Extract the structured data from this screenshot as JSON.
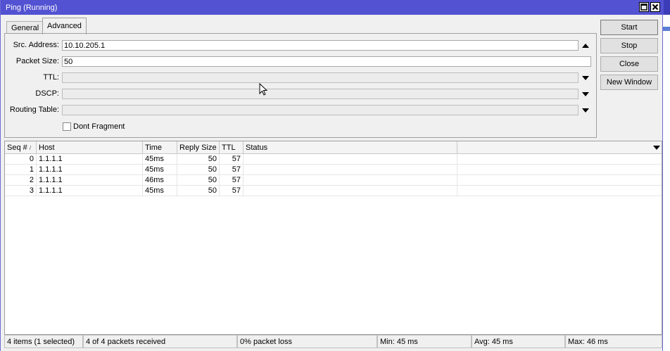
{
  "window": {
    "title": "Ping (Running)"
  },
  "tabs": [
    {
      "label": "General"
    },
    {
      "label": "Advanced"
    }
  ],
  "form": {
    "src_address": {
      "label": "Src. Address:",
      "value": "10.10.205.1"
    },
    "packet_size": {
      "label": "Packet Size:",
      "value": "50"
    },
    "ttl": {
      "label": "TTL:",
      "value": ""
    },
    "dscp": {
      "label": "DSCP:",
      "value": ""
    },
    "routing_table": {
      "label": "Routing Table:",
      "value": ""
    },
    "dont_fragment": {
      "label": "Dont Fragment",
      "checked": false
    }
  },
  "buttons": {
    "start": "Start",
    "stop": "Stop",
    "close": "Close",
    "new_window": "New Window"
  },
  "table": {
    "columns": [
      "Seq #",
      "Host",
      "Time",
      "Reply Size",
      "TTL",
      "Status"
    ],
    "sort_mark": "/",
    "rows": [
      {
        "seq": "0",
        "host": "1.1.1.1",
        "time": "45ms",
        "reply_size": "50",
        "ttl": "57",
        "status": ""
      },
      {
        "seq": "1",
        "host": "1.1.1.1",
        "time": "45ms",
        "reply_size": "50",
        "ttl": "57",
        "status": ""
      },
      {
        "seq": "2",
        "host": "1.1.1.1",
        "time": "46ms",
        "reply_size": "50",
        "ttl": "57",
        "status": ""
      },
      {
        "seq": "3",
        "host": "1.1.1.1",
        "time": "45ms",
        "reply_size": "50",
        "ttl": "57",
        "status": ""
      }
    ]
  },
  "statusbar": {
    "items": "4 items (1 selected)",
    "received": "4 of 4 packets received",
    "loss": "0% packet loss",
    "min": "Min: 45 ms",
    "avg": "Avg: 45 ms",
    "max": "Max: 46 ms"
  },
  "colors": {
    "titlebar": "#5252d2",
    "window_bg": "#f0f0f0"
  }
}
